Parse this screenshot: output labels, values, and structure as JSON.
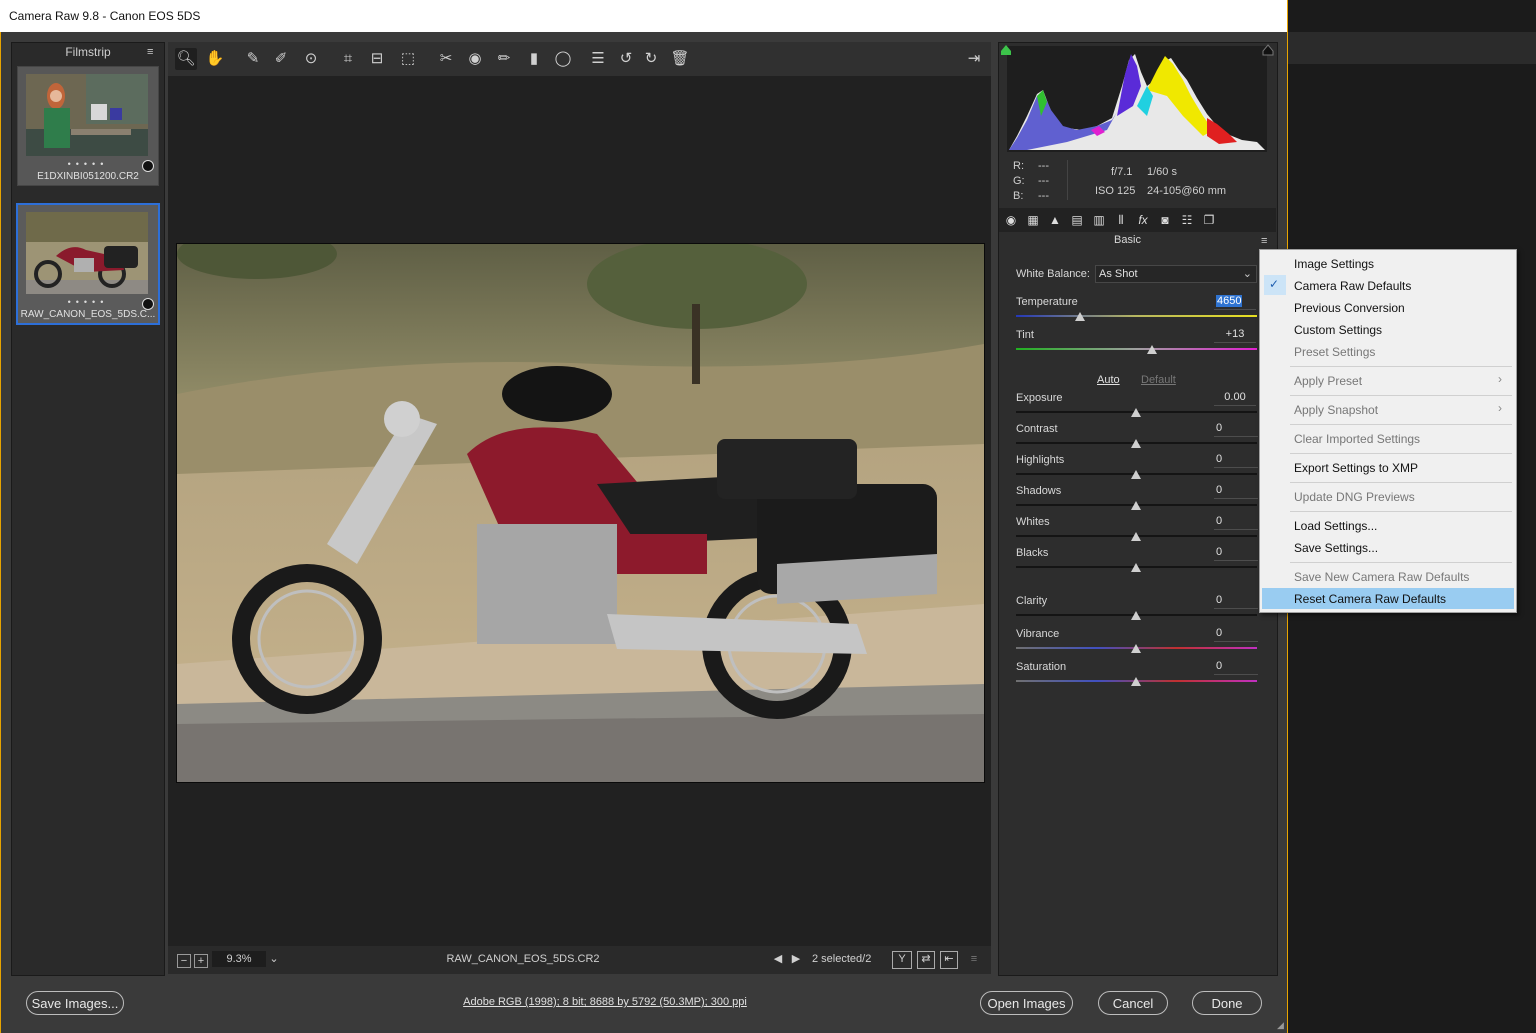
{
  "window": {
    "title": "Camera Raw 9.8  -  Canon EOS 5DS"
  },
  "filmstrip": {
    "title": "Filmstrip",
    "items": [
      {
        "name": "E1DXINBI051200.CR2",
        "selected": false
      },
      {
        "name": "RAW_CANON_EOS_5DS.C...",
        "selected": true
      }
    ]
  },
  "toolbar": {
    "tools": [
      "zoom-tool",
      "hand-tool",
      "white-balance-tool",
      "color-sampler-tool",
      "targeted-adjustment-tool",
      "crop-tool",
      "straighten-tool",
      "transform-tool",
      "spot-removal-tool",
      "red-eye-tool",
      "adjustment-brush",
      "graduated-filter",
      "radial-filter",
      "preferences",
      "rotate-left",
      "rotate-right",
      "trash"
    ]
  },
  "histogram": {
    "r_label": "R:",
    "g_label": "G:",
    "b_label": "B:",
    "r": "---",
    "g": "---",
    "b": "---",
    "aperture": "f/7.1",
    "shutter": "1/60 s",
    "iso": "ISO 125",
    "lens": "24-105@60 mm"
  },
  "panel": {
    "title": "Basic",
    "white_balance_label": "White Balance:",
    "white_balance_value": "As Shot",
    "temperature": {
      "label": "Temperature",
      "value": "4650"
    },
    "tint": {
      "label": "Tint",
      "value": "+13"
    },
    "auto_label": "Auto",
    "default_label": "Default",
    "sliders": [
      {
        "label": "Exposure",
        "value": "0.00"
      },
      {
        "label": "Contrast",
        "value": "0"
      },
      {
        "label": "Highlights",
        "value": "0"
      },
      {
        "label": "Shadows",
        "value": "0"
      },
      {
        "label": "Whites",
        "value": "0"
      },
      {
        "label": "Blacks",
        "value": "0"
      },
      {
        "label": "Clarity",
        "value": "0"
      },
      {
        "label": "Vibrance",
        "value": "0"
      },
      {
        "label": "Saturation",
        "value": "0"
      }
    ]
  },
  "menu": {
    "items": [
      {
        "label": "Image Settings",
        "enabled": true
      },
      {
        "label": "Camera Raw Defaults",
        "enabled": true,
        "checked": true
      },
      {
        "label": "Previous Conversion",
        "enabled": true
      },
      {
        "label": "Custom Settings",
        "enabled": true
      },
      {
        "label": "Preset Settings",
        "enabled": false
      },
      {
        "label": "Apply Preset",
        "enabled": false,
        "submenu": true
      },
      {
        "label": "Apply Snapshot",
        "enabled": false,
        "submenu": true
      },
      {
        "label": "Clear Imported Settings",
        "enabled": false
      },
      {
        "label": "Export Settings to XMP",
        "enabled": true
      },
      {
        "label": "Update DNG Previews",
        "enabled": false
      },
      {
        "label": "Load Settings...",
        "enabled": true
      },
      {
        "label": "Save Settings...",
        "enabled": true
      },
      {
        "label": "Save New Camera Raw Defaults",
        "enabled": false
      },
      {
        "label": "Reset Camera Raw Defaults",
        "enabled": true,
        "highlighted": true
      }
    ]
  },
  "statusbar": {
    "zoom": "9.3%",
    "filename": "RAW_CANON_EOS_5DS.CR2",
    "selection": "2 selected/2"
  },
  "bottom": {
    "save_images": "Save Images...",
    "workflow": "Adobe RGB (1998); 8 bit; 8688 by 5792 (50.3MP); 300 ppi",
    "open_images": "Open Images",
    "cancel": "Cancel",
    "done": "Done"
  },
  "colors": {
    "accent_border": "#e8a400",
    "selection_blue": "#2d6fd8",
    "menu_highlight": "#99ccf1"
  }
}
